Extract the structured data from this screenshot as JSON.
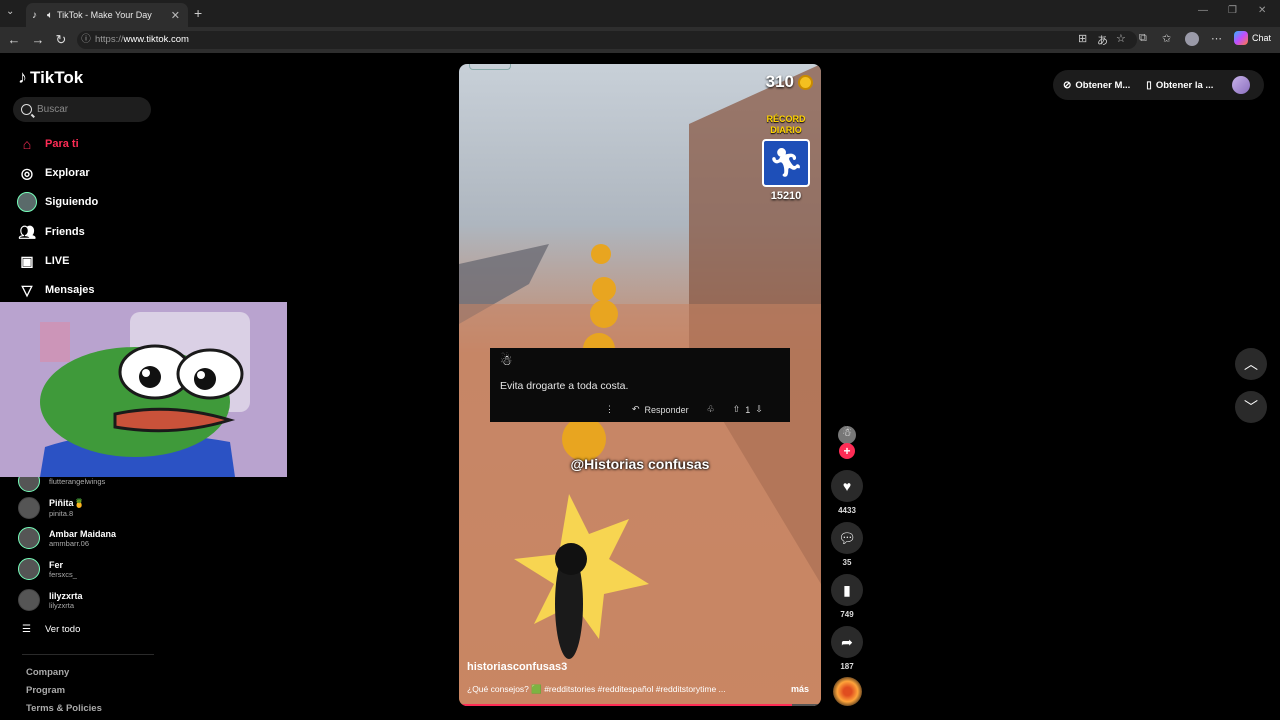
{
  "browser": {
    "tab_title": "TikTok - Make Your Day",
    "url_prefix": "https://",
    "url_host": "www.tiktok.com",
    "chat_label": "Chat"
  },
  "sidebar": {
    "logo_text": "TikTok",
    "search_placeholder": "Buscar",
    "nav": [
      {
        "label": "Para ti"
      },
      {
        "label": "Explorar"
      },
      {
        "label": "Siguiendo"
      },
      {
        "label": "Friends"
      },
      {
        "label": "LIVE"
      },
      {
        "label": "Mensajes"
      }
    ],
    "following": [
      {
        "name": "",
        "user": "flutterangelwings"
      },
      {
        "name": "Piñita🍍",
        "user": "pinita.8"
      },
      {
        "name": "Ambar Maidana",
        "user": "ammbarr.06"
      },
      {
        "name": "Fer",
        "user": "fersxcs_"
      },
      {
        "name": "lilyzxrta",
        "user": "lilyzxrta"
      }
    ],
    "see_all": "Ver todo",
    "footer": [
      "Company",
      "Program",
      "Terms & Policies"
    ]
  },
  "video": {
    "coins": "310",
    "record_label_1": "RÉCORD",
    "record_label_2": "DIARIO",
    "record_value": "15210",
    "comment_text": "Evita drogarte a toda costa.",
    "reply_label": "Responder",
    "vote_count": "1",
    "watermark": "@Historias confusas",
    "author": "historiasconfusas3",
    "caption": "¿Qué consejos? 🟩 #redditstories #redditespañol #redditstorytime ...",
    "more": "más",
    "progress": 0.92
  },
  "actions": {
    "likes": "4433",
    "comments": "35",
    "saves": "749",
    "shares": "187"
  },
  "topright": {
    "btn1": "Obtener M...",
    "btn2": "Obtener la ..."
  }
}
